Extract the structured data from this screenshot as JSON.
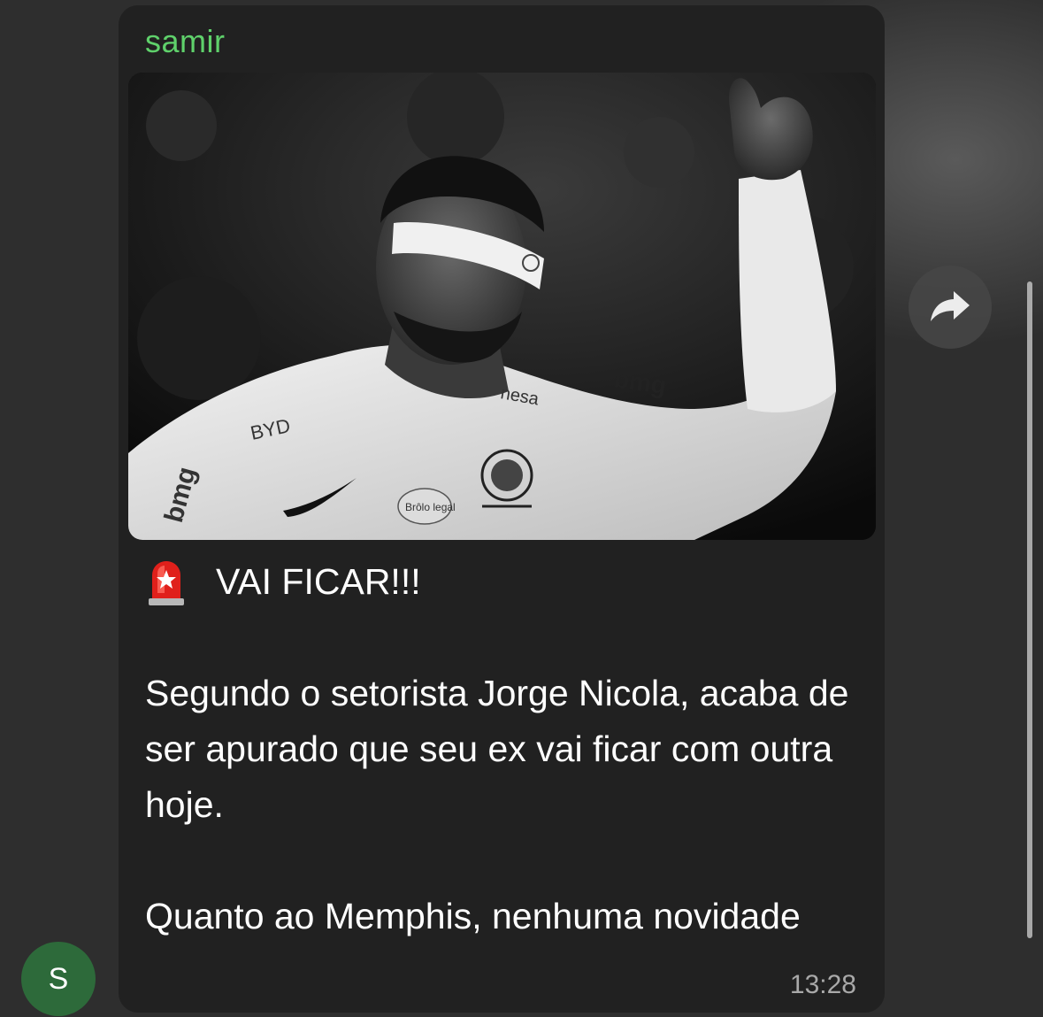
{
  "message": {
    "sender": "samir",
    "headline": "VAI FICAR!!!",
    "paragraph_1": "Segundo o setorista Jorge Nicola, acaba de ser apurado que seu ex vai ficar com outra hoje.",
    "paragraph_2": "Quanto ao Memphis, nenhuma novidade",
    "time": "13:28",
    "headline_icon": "police-siren-icon",
    "photo": {
      "subject": "football-player-thumbs-up-photo",
      "jersey_sponsor_right": "bmg",
      "jersey_sponsor_chest": "nesa",
      "jersey_sponsor_left": "BYD",
      "jersey_sleeve": "bmg",
      "jersey_badge_1": "Brôlo legal"
    }
  },
  "avatar": {
    "initial": "S",
    "color": "#2d6a3a"
  },
  "colors": {
    "sender_name": "#5fd16b",
    "bubble": "#212121",
    "timestamp": "#a9a9a9"
  },
  "actions": {
    "forward_icon": "forward-arrow-icon"
  }
}
